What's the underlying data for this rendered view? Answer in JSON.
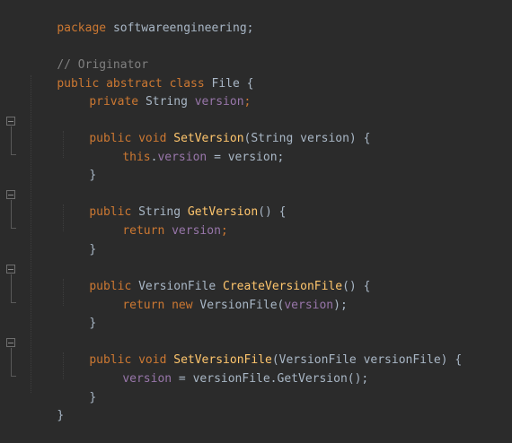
{
  "editor": {
    "lines": {
      "l1": [
        "package",
        "softwareengineering;"
      ],
      "l2": [
        "// Originator"
      ],
      "l3": [
        "public",
        "abstract",
        "class",
        "File {"
      ],
      "l4": [
        "private",
        "String",
        "version",
        ";"
      ],
      "l5": [
        "public",
        "void",
        "SetVersion",
        "(String version) {"
      ],
      "l6": [
        "this",
        ".",
        "version",
        " = version;"
      ],
      "l7": [
        "}"
      ],
      "l8": [
        "public",
        "String",
        "GetVersion",
        "() {"
      ],
      "l9": [
        "return",
        "version",
        ";"
      ],
      "l10": [
        "}"
      ],
      "l11": [
        "public",
        "VersionFile",
        "CreateVersionFile",
        "() {"
      ],
      "l12": [
        "return",
        "new",
        "VersionFile(",
        "version",
        ");"
      ],
      "l13": [
        "}"
      ],
      "l14": [
        "public",
        "void",
        "SetVersionFile",
        "(VersionFile versionFile) {"
      ],
      "l15": [
        "version",
        " = versionFile.GetVersion();"
      ],
      "l16": [
        "}"
      ],
      "l17": [
        "}"
      ]
    }
  },
  "colors": {
    "background": "#2b2b2b",
    "keyword": "#cc7832",
    "comment": "#808080",
    "method": "#ffc66d",
    "field": "#9876aa",
    "plain": "#a9b7c6"
  }
}
